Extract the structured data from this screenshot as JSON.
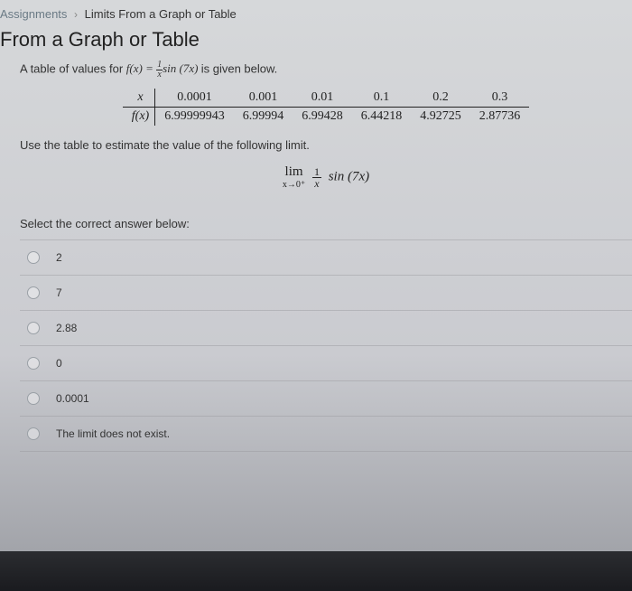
{
  "breadcrumb": {
    "parent": "Assignments",
    "current": "Limits From a Graph or Table"
  },
  "title": "From a Graph or Table",
  "intro_prefix": "A table of values for ",
  "intro_func_lhs": "f(x) = ",
  "intro_frac_num": "1",
  "intro_frac_den": "x",
  "intro_func_rest": "sin (7x)",
  "intro_suffix": " is given below.",
  "table": {
    "x_label": "x",
    "fx_label": "f(x)",
    "x_values": [
      "0.0001",
      "0.001",
      "0.01",
      "0.1",
      "0.2",
      "0.3"
    ],
    "fx_values": [
      "6.99999943",
      "6.99994",
      "6.99428",
      "6.44218",
      "4.92725",
      "2.87736"
    ]
  },
  "instruction": "Use the table to estimate the value of the following limit.",
  "limit": {
    "lim_text": "lim",
    "approach": "x→0⁺",
    "frac_num": "1",
    "frac_den": "x",
    "rest": "sin (7x)"
  },
  "select_prompt": "Select the correct answer below:",
  "options": [
    "2",
    "7",
    "2.88",
    "0",
    "0.0001",
    "The limit does not exist."
  ]
}
